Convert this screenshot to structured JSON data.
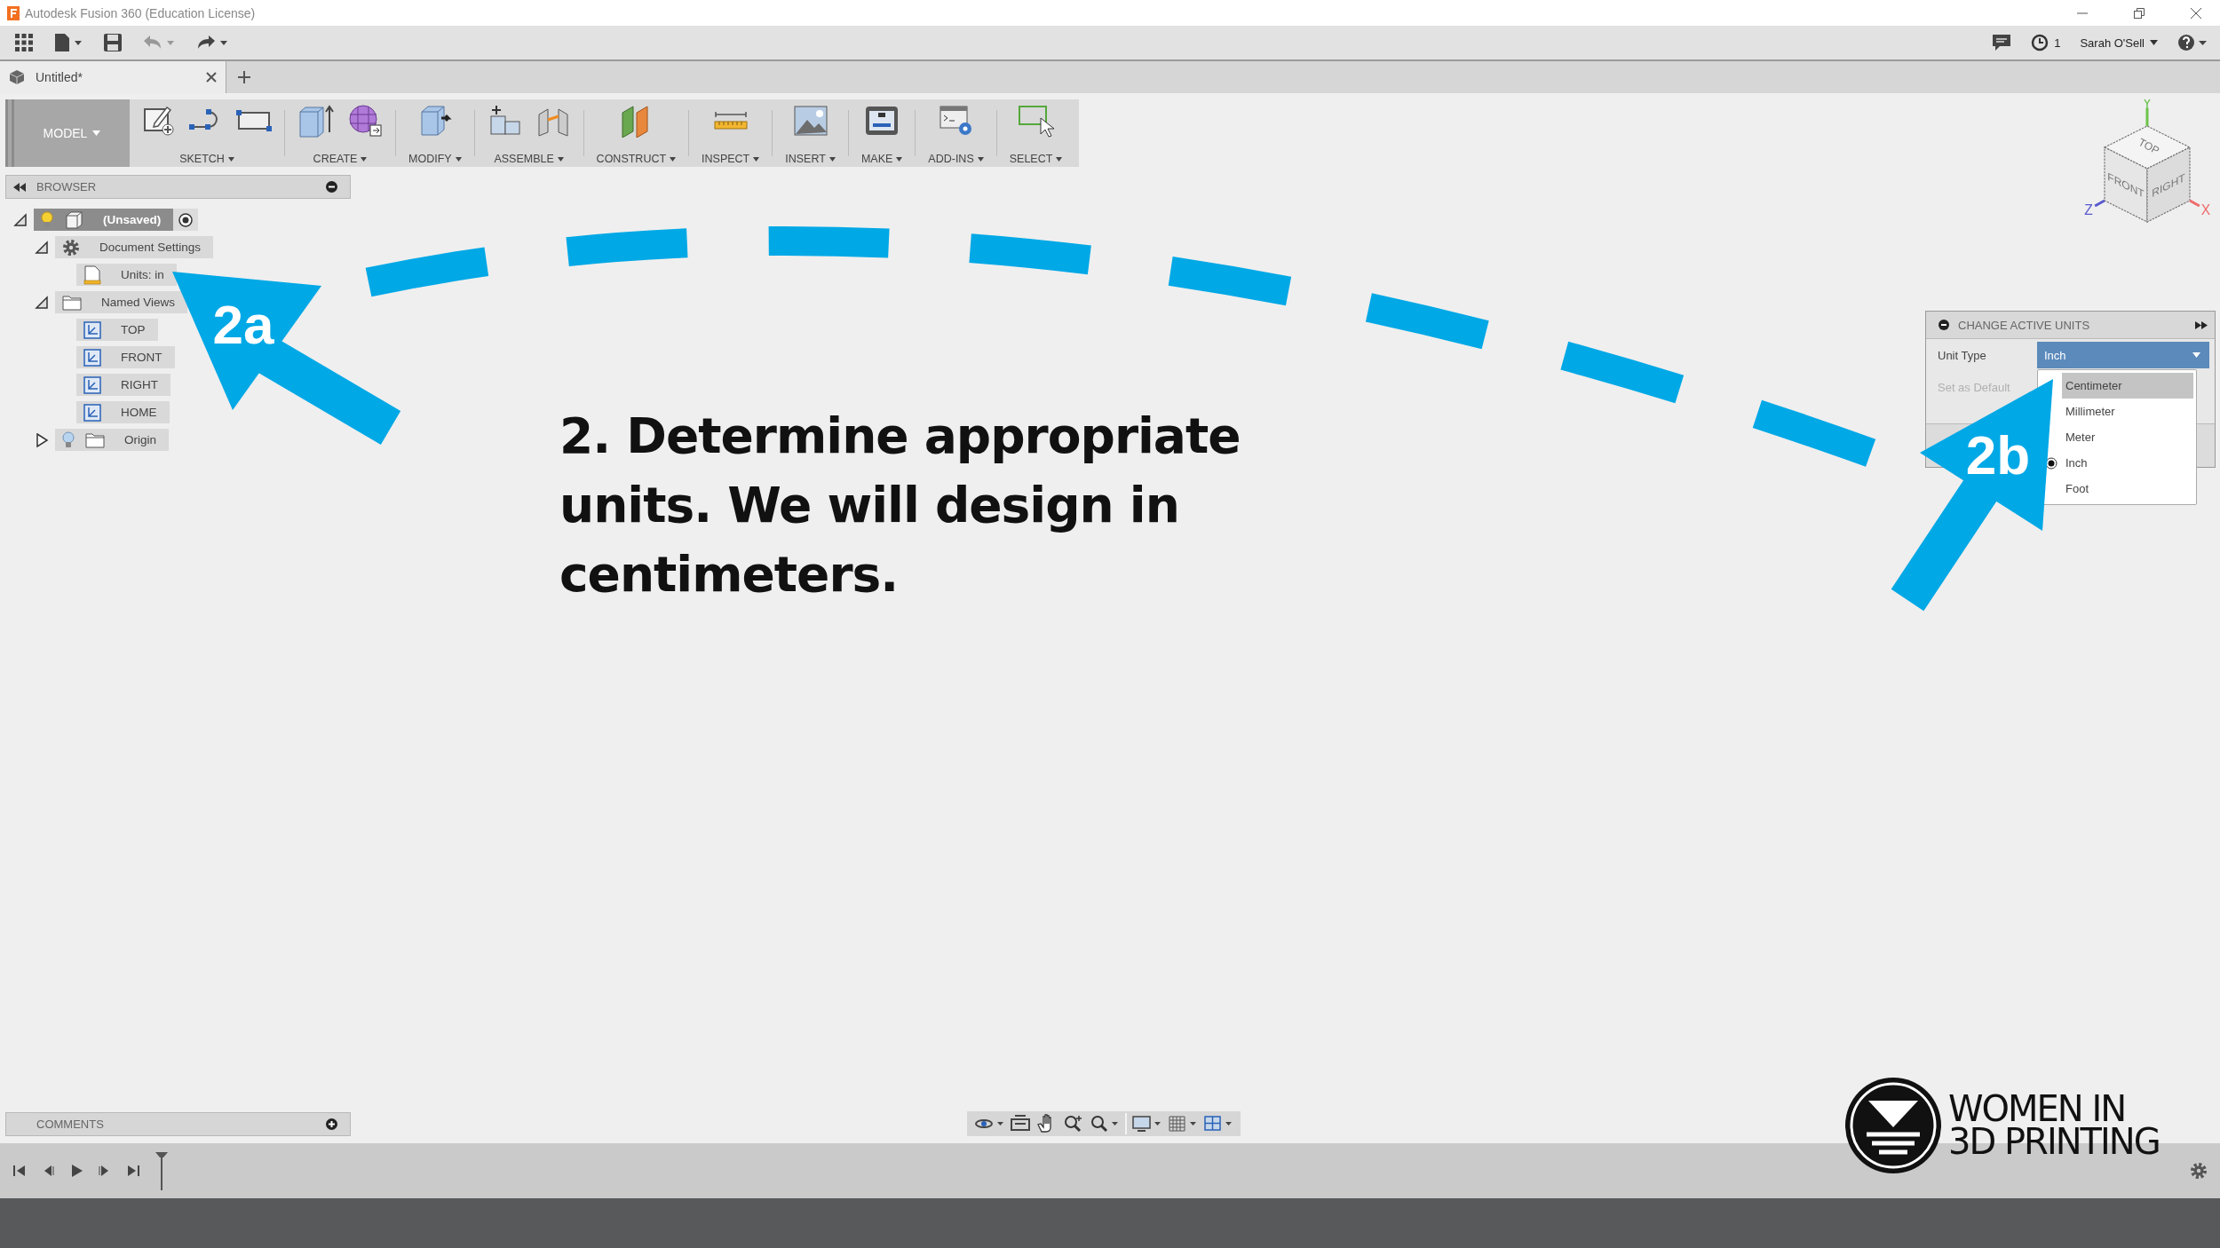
{
  "window": {
    "title": "Autodesk Fusion 360 (Education License)"
  },
  "app_bar": {
    "job_count": "1",
    "user": "Sarah O'Sell"
  },
  "tabs": [
    {
      "label": "Untitled*",
      "selected": true
    }
  ],
  "workspace": {
    "label": "MODEL"
  },
  "ribbon": [
    {
      "label": "SKETCH"
    },
    {
      "label": "CREATE"
    },
    {
      "label": "MODIFY"
    },
    {
      "label": "ASSEMBLE"
    },
    {
      "label": "CONSTRUCT"
    },
    {
      "label": "INSPECT"
    },
    {
      "label": "INSERT"
    },
    {
      "label": "MAKE"
    },
    {
      "label": "ADD-INS"
    },
    {
      "label": "SELECT"
    }
  ],
  "browser": {
    "title": "BROWSER",
    "tree": [
      {
        "label": "(Unsaved)",
        "kind": "component",
        "active": true,
        "visible": true,
        "expanded": true,
        "children": [
          {
            "label": "Document Settings",
            "kind": "settings",
            "expanded": true,
            "children": [
              {
                "label": "Units: in",
                "kind": "units"
              }
            ]
          },
          {
            "label": "Named Views",
            "kind": "folder",
            "expanded": true,
            "children": [
              {
                "label": "TOP",
                "kind": "view"
              },
              {
                "label": "FRONT",
                "kind": "view"
              },
              {
                "label": "RIGHT",
                "kind": "view"
              },
              {
                "label": "HOME",
                "kind": "view"
              }
            ]
          },
          {
            "label": "Origin",
            "kind": "folder",
            "visible": false,
            "expanded": false
          }
        ]
      }
    ]
  },
  "comments": {
    "title": "COMMENTS"
  },
  "viewcube": {
    "faces": [
      "TOP",
      "FRONT",
      "RIGHT"
    ],
    "axes": [
      "Y",
      "Z",
      "X"
    ]
  },
  "units_panel": {
    "title": "CHANGE ACTIVE UNITS",
    "unit_type": {
      "label": "Unit Type",
      "value": "Inch"
    },
    "set_default": {
      "label": "Set as Default",
      "disabled": true
    },
    "options": [
      {
        "label": "Centimeter",
        "highlighted": true,
        "selected": false
      },
      {
        "label": "Millimeter",
        "highlighted": false,
        "selected": false
      },
      {
        "label": "Meter",
        "highlighted": false,
        "selected": false
      },
      {
        "label": "Inch",
        "highlighted": false,
        "selected": true
      },
      {
        "label": "Foot",
        "highlighted": false,
        "selected": false
      }
    ]
  },
  "annotation": {
    "caption": "2. Determine appropriate units. We will design in centimeters.",
    "callouts": [
      "2a",
      "2b"
    ]
  },
  "logo": {
    "lines": [
      "WOMEN IN",
      "3D PRINTING"
    ]
  }
}
